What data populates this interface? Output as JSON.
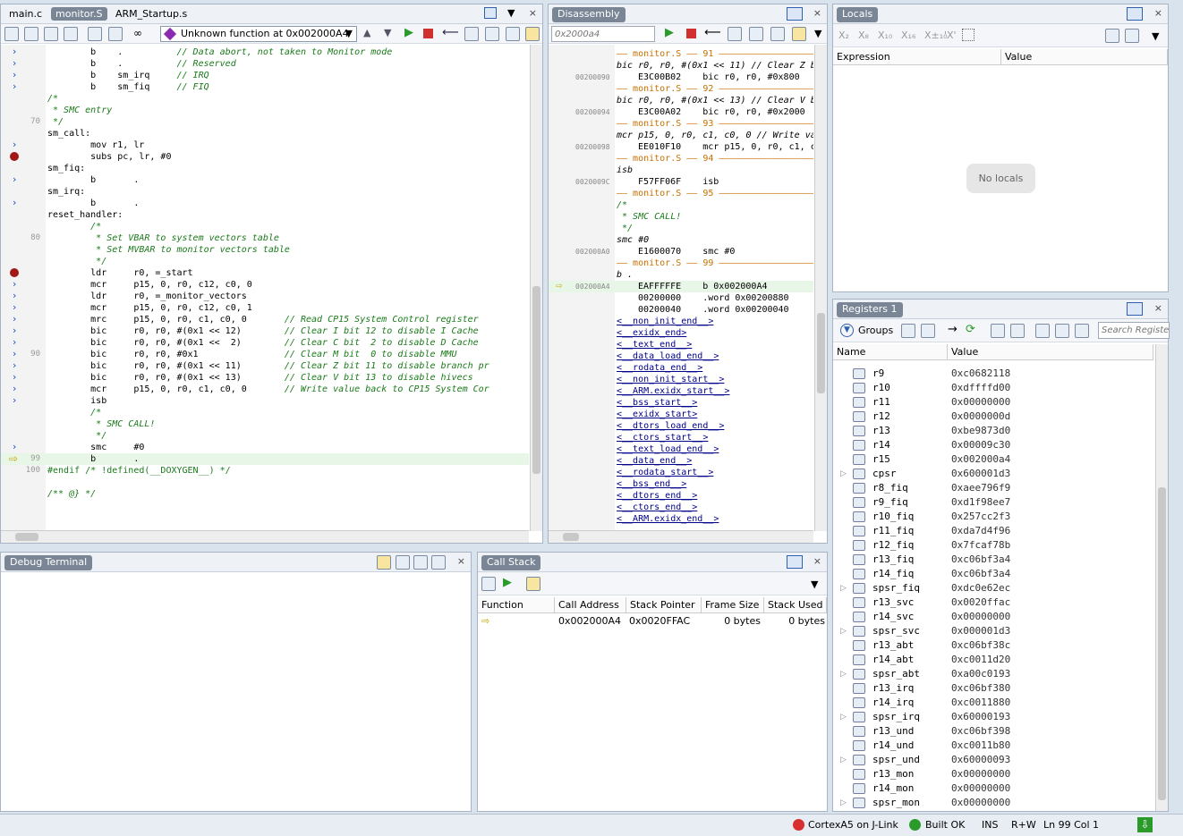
{
  "editor": {
    "tabs": [
      "main.c",
      "monitor.S",
      "ARM_Startup.s"
    ],
    "function_selector": "Unknown function at 0x002000A4"
  },
  "code_lines": [
    {
      "t": "        b    .          // Data abort, not taken to Monitor mode",
      "m": "arrow"
    },
    {
      "t": "        b    .          // Reserved",
      "m": "arrow"
    },
    {
      "t": "        b    sm_irq     // IRQ",
      "m": "arrow"
    },
    {
      "t": "        b    sm_fiq     // FIQ",
      "m": "arrow"
    },
    {
      "t": "/*",
      "m": ""
    },
    {
      "t": " * SMC entry",
      "m": ""
    },
    {
      "t": " */",
      "m": "",
      "ln": "70"
    },
    {
      "t": "sm_call:",
      "m": ""
    },
    {
      "t": "        mov r1, lr",
      "m": "arrow"
    },
    {
      "t": "        subs pc, lr, #0",
      "m": "bp"
    },
    {
      "t": "sm_fiq:",
      "m": ""
    },
    {
      "t": "        b       .",
      "m": "arrow"
    },
    {
      "t": "sm_irq:",
      "m": ""
    },
    {
      "t": "        b       .",
      "m": "arrow"
    },
    {
      "t": "reset_handler:",
      "m": ""
    },
    {
      "t": "        /*",
      "m": ""
    },
    {
      "t": "         * Set VBAR to system vectors table",
      "m": "",
      "ln": "80"
    },
    {
      "t": "         * Set MVBAR to monitor vectors table",
      "m": ""
    },
    {
      "t": "         */",
      "m": ""
    },
    {
      "t": "        ldr     r0, =_start",
      "m": "bp"
    },
    {
      "t": "        mcr     p15, 0, r0, c12, c0, 0",
      "m": "arrow"
    },
    {
      "t": "        ldr     r0, =_monitor_vectors",
      "m": "arrow"
    },
    {
      "t": "        mcr     p15, 0, r0, c12, c0, 1",
      "m": "arrow"
    },
    {
      "t": "        mrc     p15, 0, r0, c1, c0, 0       // Read CP15 System Control register",
      "m": "arrow"
    },
    {
      "t": "        bic     r0, r0, #(0x1 << 12)        // Clear I bit 12 to disable I Cache",
      "m": "arrow"
    },
    {
      "t": "        bic     r0, r0, #(0x1 <<  2)        // Clear C bit  2 to disable D Cache",
      "m": "arrow"
    },
    {
      "t": "        bic     r0, r0, #0x1                // Clear M bit  0 to disable MMU",
      "m": "arrow",
      "ln": "90"
    },
    {
      "t": "        bic     r0, r0, #(0x1 << 11)        // Clear Z bit 11 to disable branch pr",
      "m": "arrow"
    },
    {
      "t": "        bic     r0, r0, #(0x1 << 13)        // Clear V bit 13 to disable hivecs",
      "m": "arrow"
    },
    {
      "t": "        mcr     p15, 0, r0, c1, c0, 0       // Write value back to CP15 System Cor",
      "m": "arrow"
    },
    {
      "t": "        isb",
      "m": "arrow"
    },
    {
      "t": "        /*",
      "m": ""
    },
    {
      "t": "         * SMC CALL!",
      "m": ""
    },
    {
      "t": "         */",
      "m": ""
    },
    {
      "t": "        smc     #0",
      "m": "arrow"
    },
    {
      "t": "        b       .",
      "m": "pc",
      "ln": "99"
    },
    {
      "t": "#endif /* !defined(__DOXYGEN__) */",
      "m": "",
      "ln": "100"
    },
    {
      "t": "",
      "m": ""
    },
    {
      "t": "/** @} */",
      "m": ""
    }
  ],
  "disassembly": {
    "title": "Disassembly",
    "address_input": "0x2000a4",
    "lines": [
      {
        "k": "sep",
        "t": "—— monitor.S —— 91 ——————————————————————"
      },
      {
        "k": "src",
        "t": "bic r0, r0, #(0x1 << 11) // Clear Z b"
      },
      {
        "k": "ins",
        "a": "00200090",
        "t": "E3C00B02    bic r0, r0, #0x800"
      },
      {
        "k": "sep",
        "t": "—— monitor.S —— 92 ——————————————————————"
      },
      {
        "k": "src",
        "t": "bic r0, r0, #(0x1 << 13) // Clear V b"
      },
      {
        "k": "ins",
        "a": "00200094",
        "t": "E3C00A02    bic r0, r0, #0x2000"
      },
      {
        "k": "sep",
        "t": "—— monitor.S —— 93 ——————————————————————"
      },
      {
        "k": "src",
        "t": "mcr p15, 0, r0, c1, c0, 0 // Write va"
      },
      {
        "k": "ins",
        "a": "00200098",
        "t": "EE010F10    mcr p15, 0, r0, c1, c"
      },
      {
        "k": "sep",
        "t": "—— monitor.S —— 94 ——————————————————————"
      },
      {
        "k": "src",
        "t": "isb"
      },
      {
        "k": "ins",
        "a": "0020009C",
        "t": "F57FF06F    isb"
      },
      {
        "k": "sep",
        "t": "—— monitor.S —— 95 ——————————————————————"
      },
      {
        "k": "src",
        "t": "/*"
      },
      {
        "k": "src",
        "t": " * SMC CALL!"
      },
      {
        "k": "src",
        "t": " */"
      },
      {
        "k": "src",
        "t": "smc #0"
      },
      {
        "k": "ins",
        "a": "002000A0",
        "t": "E1600070    smc #0"
      },
      {
        "k": "sep",
        "t": "—— monitor.S —— 99 ——————————————————————"
      },
      {
        "k": "src",
        "t": "b ."
      },
      {
        "k": "pc",
        "a": "002000A4",
        "t": "EAFFFFFE    b 0x002000A4"
      },
      {
        "k": "ins",
        "a": "",
        "t": "00200000    .word 0x00200880"
      },
      {
        "k": "ins",
        "a": "",
        "t": "00200040    .word 0x00200040"
      },
      {
        "k": "sym",
        "t": "<__non_init_end__>"
      },
      {
        "k": "sym",
        "t": "<__exidx_end>"
      },
      {
        "k": "sym",
        "t": "<__text_end__>"
      },
      {
        "k": "sym",
        "t": "<__data_load_end__>"
      },
      {
        "k": "sym",
        "t": "<__rodata_end__>"
      },
      {
        "k": "sym",
        "t": "<__non_init_start__>"
      },
      {
        "k": "sym",
        "t": "<__ARM.exidx_start__>"
      },
      {
        "k": "sym",
        "t": "<__bss_start__>"
      },
      {
        "k": "sym",
        "t": "<__exidx_start>"
      },
      {
        "k": "sym",
        "t": "<__dtors_load_end__>"
      },
      {
        "k": "sym",
        "t": "<__ctors_start__>"
      },
      {
        "k": "sym",
        "t": "<__text_load_end__>"
      },
      {
        "k": "sym",
        "t": "<__data_end__>"
      },
      {
        "k": "sym",
        "t": "<__rodata_start__>"
      },
      {
        "k": "sym",
        "t": "<__bss_end__>"
      },
      {
        "k": "sym",
        "t": "<__dtors_end__>"
      },
      {
        "k": "sym",
        "t": "<__ctors_end__>"
      },
      {
        "k": "sym",
        "t": "<__ARM.exidx_end__>"
      }
    ]
  },
  "locals": {
    "title": "Locals",
    "col_expression": "Expression",
    "col_value": "Value",
    "empty": "No locals",
    "toolbar": [
      "X₂",
      "X₈",
      "X₁₀",
      "X₁₆",
      "X±₁₀",
      "'X'"
    ]
  },
  "registers": {
    "title": "Registers 1",
    "groups_label": "Groups",
    "search_placeholder": "Search Registers",
    "col_name": "Name",
    "col_value": "Value",
    "rows": [
      {
        "n": "r9",
        "v": "0xc0682118",
        "e": false
      },
      {
        "n": "r10",
        "v": "0xdffffd00",
        "e": false
      },
      {
        "n": "r11",
        "v": "0x00000000",
        "e": false
      },
      {
        "n": "r12",
        "v": "0x0000000d",
        "e": false
      },
      {
        "n": "r13",
        "v": "0xbe9873d0",
        "e": false
      },
      {
        "n": "r14",
        "v": "0x00009c30",
        "e": false
      },
      {
        "n": "r15",
        "v": "0x002000a4",
        "e": false
      },
      {
        "n": "cpsr",
        "v": "0x600001d3",
        "e": true
      },
      {
        "n": "r8_fiq",
        "v": "0xaee796f9",
        "e": false
      },
      {
        "n": "r9_fiq",
        "v": "0xd1f98ee7",
        "e": false
      },
      {
        "n": "r10_fiq",
        "v": "0x257cc2f3",
        "e": false
      },
      {
        "n": "r11_fiq",
        "v": "0xda7d4f96",
        "e": false
      },
      {
        "n": "r12_fiq",
        "v": "0x7fcaf78b",
        "e": false
      },
      {
        "n": "r13_fiq",
        "v": "0xc06bf3a4",
        "e": false
      },
      {
        "n": "r14_fiq",
        "v": "0xc06bf3a4",
        "e": false
      },
      {
        "n": "spsr_fiq",
        "v": "0xdc0e62ec",
        "e": true
      },
      {
        "n": "r13_svc",
        "v": "0x0020ffac",
        "e": false
      },
      {
        "n": "r14_svc",
        "v": "0x00000000",
        "e": false
      },
      {
        "n": "spsr_svc",
        "v": "0x000001d3",
        "e": true
      },
      {
        "n": "r13_abt",
        "v": "0xc06bf38c",
        "e": false
      },
      {
        "n": "r14_abt",
        "v": "0xc0011d20",
        "e": false
      },
      {
        "n": "spsr_abt",
        "v": "0xa00c0193",
        "e": true
      },
      {
        "n": "r13_irq",
        "v": "0xc06bf380",
        "e": false
      },
      {
        "n": "r14_irq",
        "v": "0xc0011880",
        "e": false
      },
      {
        "n": "spsr_irq",
        "v": "0x60000193",
        "e": true
      },
      {
        "n": "r13_und",
        "v": "0xc06bf398",
        "e": false
      },
      {
        "n": "r14_und",
        "v": "0xc0011b80",
        "e": false
      },
      {
        "n": "spsr_und",
        "v": "0x60000093",
        "e": true
      },
      {
        "n": "r13_mon",
        "v": "0x00000000",
        "e": false
      },
      {
        "n": "r14_mon",
        "v": "0x00000000",
        "e": false
      },
      {
        "n": "spsr_mon",
        "v": "0x00000000",
        "e": true
      }
    ]
  },
  "debug_terminal": {
    "title": "Debug Terminal"
  },
  "callstack": {
    "title": "Call Stack",
    "cols": [
      "Function",
      "Call Address",
      "Stack Pointer",
      "Frame Size",
      "Stack Used"
    ],
    "row": {
      "call_address": "0x002000A4",
      "stack_pointer": "0x0020FFAC",
      "frame_size": "0 bytes",
      "stack_used": "0 bytes"
    }
  },
  "status": {
    "target": "CortexA5 on J-Link",
    "build": "Built OK",
    "mode": "INS",
    "rw": "R+W",
    "position": "Ln 99 Col 1"
  }
}
